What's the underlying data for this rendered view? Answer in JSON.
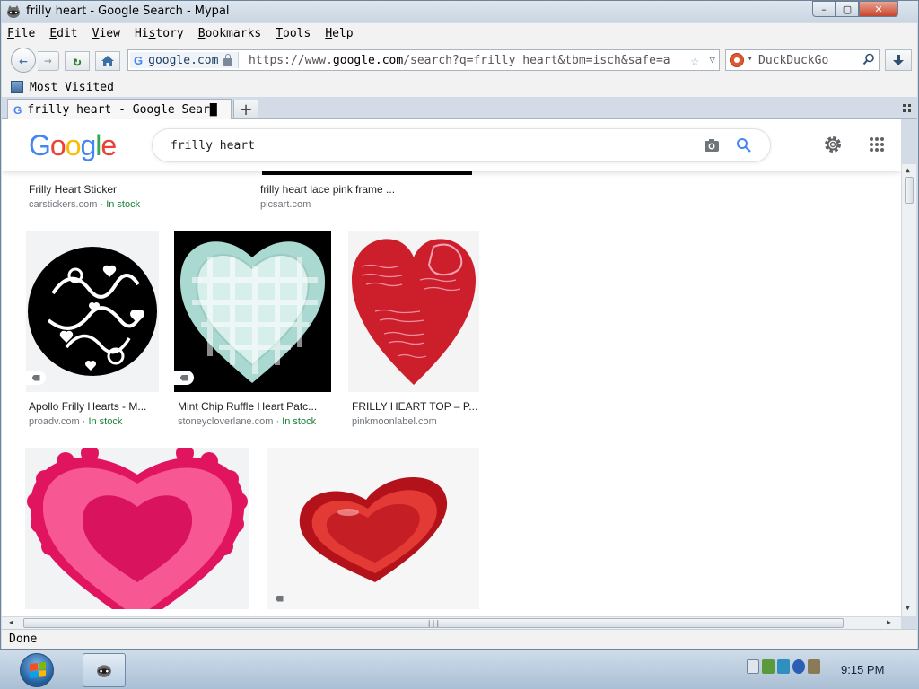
{
  "window": {
    "title": "frilly heart - Google Search - Mypal",
    "minimize_glyph": "–",
    "maximize_glyph": "▢",
    "close_glyph": "✕"
  },
  "menu": {
    "file": {
      "accel": "F",
      "rest": "ile"
    },
    "edit": {
      "accel": "E",
      "rest": "dit"
    },
    "view": {
      "accel": "V",
      "rest": "iew"
    },
    "history": {
      "pre": "Hi",
      "accel": "s",
      "rest": "tory"
    },
    "bookmarks": {
      "accel": "B",
      "rest": "ookmarks"
    },
    "tools": {
      "accel": "T",
      "rest": "ools"
    },
    "help": {
      "accel": "H",
      "rest": "elp"
    }
  },
  "nav": {
    "back_glyph": "←",
    "forward_glyph": "→",
    "reload_glyph": "↻",
    "site_identity": "google.com",
    "site_identity_icon": "G",
    "url_prefix": "https://www.",
    "url_host": "google.com",
    "url_rest": "/search?q=frilly heart&tbm=isch&safe=a",
    "bookmark_star": "☆",
    "url_dropdown": "▽",
    "search_engine": "DuckDuckGo",
    "search_engine_dropdown": "▾"
  },
  "bookmarks_bar": {
    "most_visited": "Most Visited"
  },
  "tabs": {
    "active_title": "frilly heart - Google Sear█",
    "favicon": "G",
    "new_tab_glyph": "+"
  },
  "google": {
    "logo_letters": [
      "G",
      "o",
      "o",
      "g",
      "l",
      "e"
    ],
    "logo_colors": [
      "#4285f4",
      "#ea4335",
      "#fbbc05",
      "#4285f4",
      "#34a853",
      "#ea4335"
    ],
    "query": "frilly heart"
  },
  "results": [
    {
      "title": "Frilly Heart Sticker",
      "source": "carstickers.com",
      "sep": " · ",
      "stock": "In stock"
    },
    {
      "title": "frilly heart lace pink frame ...",
      "source": "picsart.com",
      "sep": "",
      "stock": ""
    },
    {
      "title": "Apollo Frilly Hearts - M...",
      "source": "proadv.com",
      "sep": " · ",
      "stock": "In stock"
    },
    {
      "title": "Mint Chip Ruffle Heart Patc...",
      "source": "stoneycloverlane.com",
      "sep": " · ",
      "stock": "In stock"
    },
    {
      "title": "FRILLY HEART TOP – P...",
      "source": "pinkmoonlabel.com",
      "sep": "",
      "stock": ""
    }
  ],
  "status": {
    "text": "Done"
  },
  "hscroll_grip": "|||",
  "taskbar": {
    "clock": "9:15 PM"
  },
  "colors": {
    "stock_green": "#188038",
    "heart_red": "#cc1f2b",
    "pink_outer": "#f25d94",
    "pink_inner": "#d9135d",
    "mint": "#bfe3de"
  }
}
